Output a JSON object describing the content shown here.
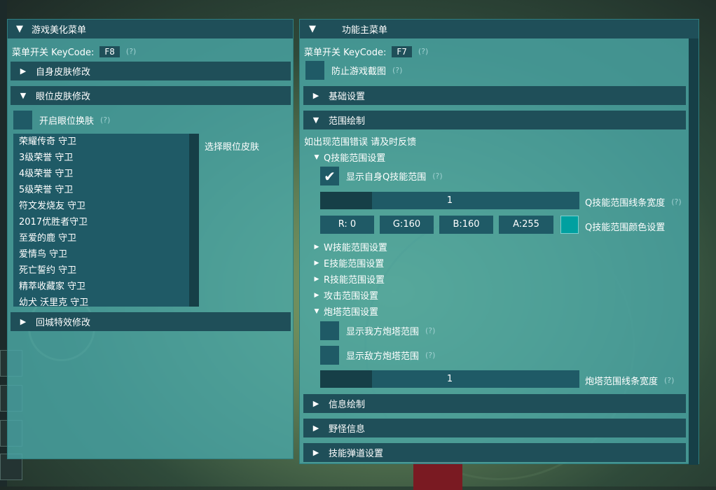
{
  "left_window": {
    "title": "游戏美化菜单",
    "menu_toggle_label": "菜单开关 KeyCode:",
    "menu_toggle_key": "F8",
    "help": "(?)",
    "sections": {
      "self_skin": "自身皮肤修改",
      "ward_skin": "眼位皮肤修改",
      "recall_effect": "回城特效修改"
    },
    "enable_ward_swap": "开启眼位换肤",
    "select_ward_skin": "选择眼位皮肤",
    "ward_skins": [
      "荣耀传奇 守卫",
      "3级荣誉 守卫",
      "4级荣誉 守卫",
      "5级荣誉 守卫",
      "符文发烧友 守卫",
      "2017优胜者守卫",
      "至爱的鹿 守卫",
      "爱情鸟 守卫",
      "死亡誓约 守卫",
      "精萃收藏家 守卫",
      "幼犬 沃里克 守卫"
    ]
  },
  "right_window": {
    "title": "功能主菜单",
    "menu_toggle_label": "菜单开关 KeyCode:",
    "menu_toggle_key": "F7",
    "help": "(?)",
    "prevent_screenshot": "防止游戏截图",
    "sections": {
      "basic": "基础设置",
      "range_draw": "范围绘制",
      "info_draw": "信息绘制",
      "jungle_info": "野怪信息",
      "skill_ballistic": "技能弹道设置"
    },
    "range_notice": "如出现范围错误 请及时反馈",
    "q_settings": "Q技能范围设置",
    "show_self_q": "显示自身Q技能范围",
    "q_line_width_value": "1",
    "q_line_width_label": "Q技能范围线条宽度",
    "q_color": {
      "r": "R:  0",
      "g": "G:160",
      "b": "B:160",
      "a": "A:255"
    },
    "q_color_label": "Q技能范围颜色设置",
    "q_color_hex": "#00a0a0",
    "w_settings": "W技能范围设置",
    "e_settings": "E技能范围设置",
    "r_settings": "R技能范围设置",
    "attack_settings": "攻击范围设置",
    "tower_settings": "炮塔范围设置",
    "show_ally_tower": "显示我方炮塔范围",
    "show_enemy_tower": "显示敌方炮塔范围",
    "tower_line_width_value": "1",
    "tower_line_width_label": "炮塔范围线条宽度"
  },
  "colors": {
    "window_bg": "#4aa8a8",
    "header_bg": "#1f4f59",
    "widget_bg": "#1f5a66"
  },
  "icons": {
    "collapsed": "▶",
    "expanded": "▼",
    "check": "✔"
  }
}
